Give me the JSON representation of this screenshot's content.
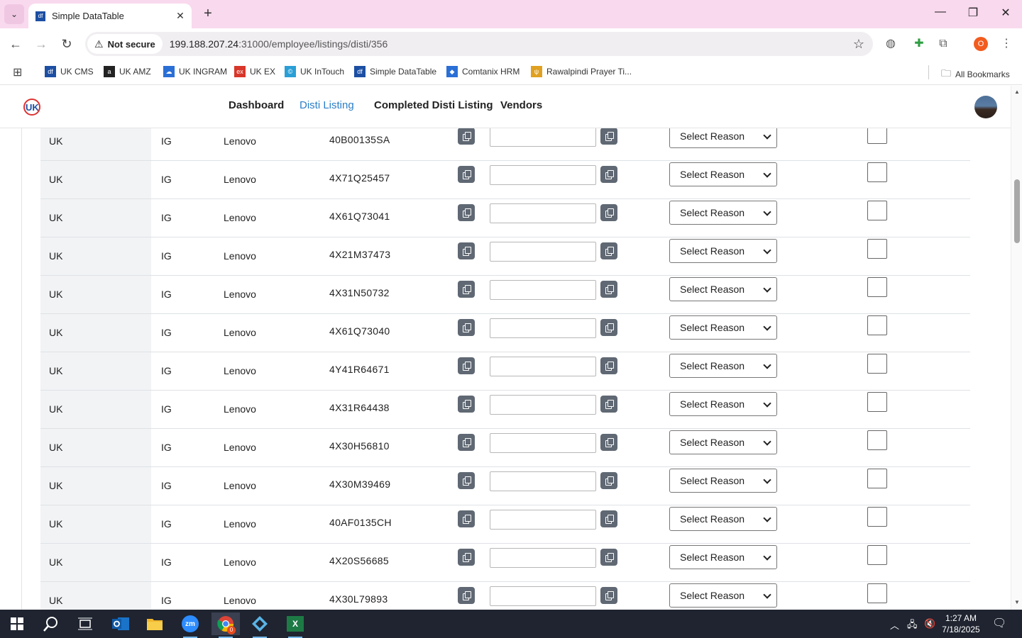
{
  "browser": {
    "tab_title": "Simple DataTable",
    "tab_favicon": "df",
    "close_tab": "✕",
    "new_tab": "+",
    "security_label": "Not secure",
    "url_host": "199.188.207.24",
    "url_path": ":31000/employee/listings/disti/356",
    "profile_initial": "O",
    "bookmarks": [
      {
        "label": "UK CMS",
        "icon": "df",
        "color": "#1c4fa3"
      },
      {
        "label": "UK AMZ",
        "icon": "a",
        "color": "#222222"
      },
      {
        "label": "UK INGRAM",
        "icon": "☁",
        "color": "#2a6fd6"
      },
      {
        "label": "UK EX",
        "icon": "ex",
        "color": "#d8362a"
      },
      {
        "label": "UK InTouch",
        "icon": "©",
        "color": "#2a9fd6"
      },
      {
        "label": "Simple DataTable",
        "icon": "df",
        "color": "#1c4fa3"
      },
      {
        "label": "Comtanix HRM",
        "icon": "◆",
        "color": "#2a6fd6"
      },
      {
        "label": "Rawalpindi Prayer Ti...",
        "icon": "ψ",
        "color": "#e0a020"
      }
    ],
    "all_bookmarks": "All Bookmarks"
  },
  "nav": {
    "items": [
      "Dashboard",
      "Disti Listing",
      "Completed Disti Listing",
      "Vendors"
    ],
    "active": "Disti Listing"
  },
  "table": {
    "select_placeholder": "Select Reason",
    "rows": [
      {
        "region": "UK",
        "code": "IG",
        "vendor": "Lenovo",
        "part": "40B00135SA"
      },
      {
        "region": "UK",
        "code": "IG",
        "vendor": "Lenovo",
        "part": "4X71Q25457"
      },
      {
        "region": "UK",
        "code": "IG",
        "vendor": "Lenovo",
        "part": "4X61Q73041"
      },
      {
        "region": "UK",
        "code": "IG",
        "vendor": "Lenovo",
        "part": "4X21M37473"
      },
      {
        "region": "UK",
        "code": "IG",
        "vendor": "Lenovo",
        "part": "4X31N50732"
      },
      {
        "region": "UK",
        "code": "IG",
        "vendor": "Lenovo",
        "part": "4X61Q73040"
      },
      {
        "region": "UK",
        "code": "IG",
        "vendor": "Lenovo",
        "part": "4Y41R64671"
      },
      {
        "region": "UK",
        "code": "IG",
        "vendor": "Lenovo",
        "part": "4X31R64438"
      },
      {
        "region": "UK",
        "code": "IG",
        "vendor": "Lenovo",
        "part": "4X30H56810"
      },
      {
        "region": "UK",
        "code": "IG",
        "vendor": "Lenovo",
        "part": "4X30M39469"
      },
      {
        "region": "UK",
        "code": "IG",
        "vendor": "Lenovo",
        "part": "40AF0135CH"
      },
      {
        "region": "UK",
        "code": "IG",
        "vendor": "Lenovo",
        "part": "4X20S56685"
      },
      {
        "region": "UK",
        "code": "IG",
        "vendor": "Lenovo",
        "part": "4X30L79893"
      }
    ]
  },
  "taskbar": {
    "time": "1:27 AM",
    "date": "7/18/2025",
    "apps": [
      "windows-start",
      "search",
      "task-view",
      "outlook",
      "file-explorer",
      "zoom",
      "chrome",
      "remote-app",
      "excel"
    ],
    "active_app": "chrome",
    "zoom_label": "zm",
    "chrome_badge": "0",
    "excel_label": "X"
  },
  "colors": {
    "tabbar": "#f9d9ee",
    "active_nav": "#2a7ec7",
    "icon_button": "#5f6873"
  }
}
